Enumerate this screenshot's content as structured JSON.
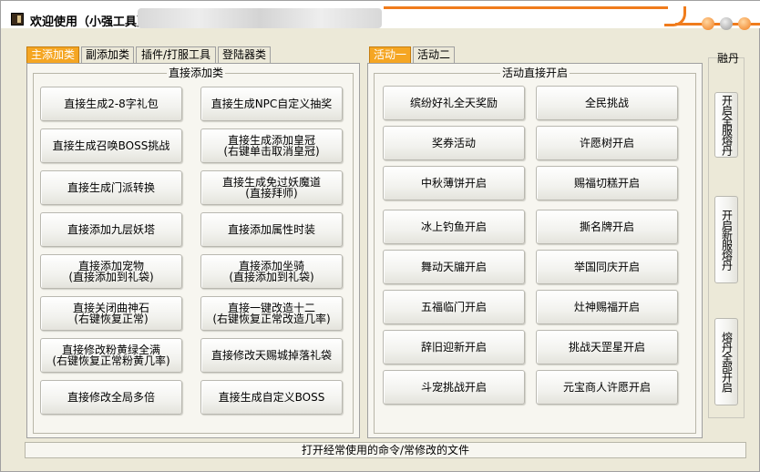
{
  "window": {
    "title": "欢迎使用（小强工具）"
  },
  "left_tabs": [
    "主添加类",
    "副添加类",
    "插件/打服工具",
    "登陆器类"
  ],
  "left_group_title": "直接添加类",
  "left_buttons": [
    "直接生成2-8字礼包",
    "直接生成NPC自定义抽奖",
    "直接生成召唤BOSS挑战",
    "直接生成添加皇冠\n(右键单击取消皇冠)",
    "直接生成门派转换",
    "直接生成免过妖魔道\n(直接拜师)",
    "直接添加九层妖塔",
    "直接添加属性时装",
    "直接添加宠物\n(直接添加到礼袋)",
    "直接添加坐骑\n(直接添加到礼袋)",
    "直接关闭曲神石\n(右键恢复正常)",
    "直接一键改造十二\n(右键恢复正常改造几率)",
    "直接修改粉黄绿全满\n(右键恢复正常粉黄几率)",
    "直接修改天赐城掉落礼袋",
    "直接修改全局多倍",
    "直接生成自定义BOSS"
  ],
  "right_tabs": [
    "活动一",
    "活动二"
  ],
  "right_group_title": "活动直接开启",
  "right_buttons": [
    "缤纷好礼全天奖励",
    "全民挑战",
    "奖券活动",
    "许愿树开启",
    "中秋薄饼开启",
    "赐福切糕开启",
    "冰上钓鱼开启",
    "撕名牌开启",
    "舞动天牖开启",
    "举国同庆开启",
    "五福临门开启",
    "灶神赐福开启",
    "辞旧迎新开启",
    "挑战天罡星开启",
    "斗宠挑战开启",
    "元宝商人许愿开启"
  ],
  "side_panel": {
    "title": "融丹",
    "buttons": [
      "开启全服熔丹",
      "开启新服熔丹",
      "熔丹全部开启"
    ]
  },
  "status_bar": "打开经常使用的命令/常修改的文件",
  "colors": {
    "accent": "#f07c1c",
    "active_tab": "#f5a623"
  }
}
